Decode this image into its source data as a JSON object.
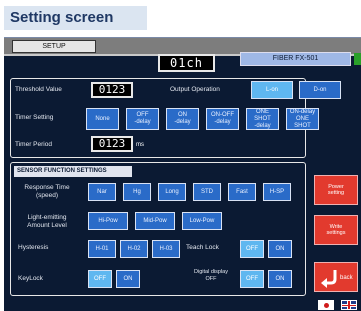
{
  "caption": "Setting screen",
  "header": {
    "setup_tab": "SETUP",
    "channel": "01ch",
    "model": "FIBER FX-501"
  },
  "main": {
    "threshold_label": "Threshold Value",
    "threshold_value": "0123",
    "output_label": "Output Operation",
    "output_options": [
      "L-on",
      "D-on"
    ],
    "timer_label": "Timer Setting",
    "timer_options": [
      "None",
      "OFF\n-delay",
      "ON\n-delay",
      "ON-OFF\n-delay",
      "ONE SHOT\n-delay",
      "ON-delay\nONE SHOT"
    ],
    "timer_period_label": "Timer Period",
    "timer_period_value": "0123",
    "timer_period_unit": "ms"
  },
  "sensor": {
    "title": "SENSOR FUNCTION SETTINGS",
    "response_label": "Response Time\n(speed)",
    "response_options": [
      "Nar",
      "Hg",
      "Long",
      "STD",
      "Fast",
      "H-SP"
    ],
    "light_label": "Light-emitting\nAmount Level",
    "light_options": [
      "Hi-Pow",
      "Mid-Pow",
      "Low-Pow"
    ],
    "hysteresis_label": "Hysteresis",
    "hysteresis_options": [
      "H-01",
      "H-02",
      "H-03"
    ],
    "teach_label": "Teach Lock",
    "teach_options": [
      "OFF",
      "ON"
    ],
    "keylock_label": "KeyLock",
    "keylock_options": [
      "OFF",
      "ON"
    ],
    "digital_label": "Digital display\nOFF",
    "digital_options": [
      "OFF",
      "ON"
    ]
  },
  "side": {
    "btn1": "Power\nsetting",
    "btn2": "Write\nsettings",
    "back": "back"
  },
  "colors": {
    "background": "#0b1a33",
    "button": "#2a6bc8",
    "selected": "#5fb7f0",
    "side_button": "#e23a2e"
  }
}
